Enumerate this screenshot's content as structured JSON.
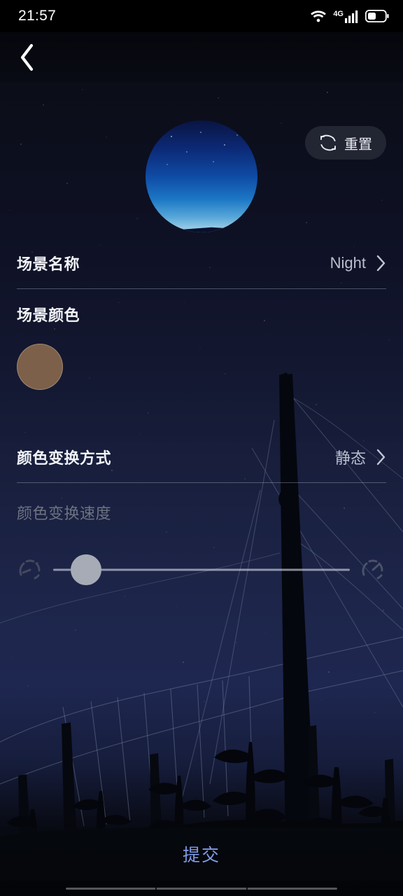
{
  "status_bar": {
    "time": "21:57",
    "wifi_icon": "wifi-icon",
    "network_label": "4G",
    "signal_icon": "signal-bars-icon",
    "battery_icon": "battery-icon"
  },
  "app_bar": {
    "back_icon": "chevron-left-icon"
  },
  "reset_button": {
    "label": "重置",
    "icon": "reset-icon"
  },
  "preview": {
    "name": "scene-preview-circle"
  },
  "rows": {
    "scene_name": {
      "label": "场景名称",
      "value": "Night",
      "chevron_icon": "chevron-right-icon"
    },
    "scene_color": {
      "label": "场景颜色",
      "swatch_color": "#7d6049"
    },
    "color_mode": {
      "label": "颜色变换方式",
      "value": "静态",
      "chevron_icon": "chevron-right-icon"
    },
    "color_speed": {
      "label": "颜色变换速度",
      "slow_icon": "speed-slow-gauge-icon",
      "fast_icon": "speed-fast-gauge-icon",
      "slider_value": 6,
      "slider_min": 0,
      "slider_max": 100,
      "disabled": true
    }
  },
  "submit_button": {
    "label": "提交"
  },
  "colors": {
    "accent": "#7f9be9",
    "swatch": "#7d6049",
    "divider": "rgba(205,212,228,.32)",
    "label": "#f2f4f8",
    "value": "#b9bfcc",
    "disabled_label": "#6d7381"
  },
  "nav_bar": {
    "name": "system-nav-bar"
  }
}
